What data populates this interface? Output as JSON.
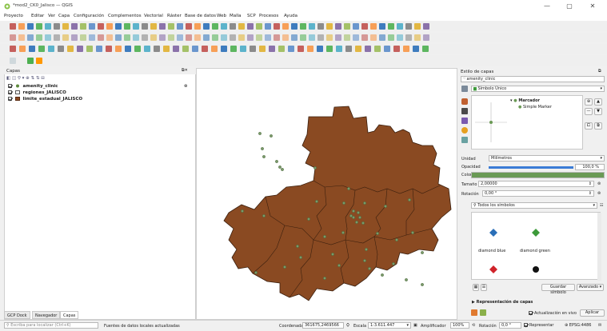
{
  "window": {
    "title": "*mod2_CK0_Jalisco — QGIS",
    "minimize": "—",
    "restore": "▢",
    "close": "✕"
  },
  "menu": [
    "Proyecto",
    "Editar",
    "Ver",
    "Capa",
    "Configuración",
    "Complementos",
    "Vectorial",
    "Ráster",
    "Base de datos",
    "Web",
    "Malla",
    "SCP",
    "Procesos",
    "Ayuda"
  ],
  "layers_panel": {
    "title": "Capas",
    "layers": [
      {
        "name": "amenity_clinic",
        "checked": true,
        "symbol": "point",
        "color": "#5d8a3c"
      },
      {
        "name": "regiones_JALISCO",
        "checked": true,
        "symbol": "empty",
        "color": "#ffffff"
      },
      {
        "name": "limite_estadual_JALISCO",
        "checked": true,
        "symbol": "fill",
        "color": "#8a4a22"
      }
    ],
    "tabs": [
      "GCP Dock",
      "Navegador",
      "Capas"
    ]
  },
  "style_panel": {
    "title": "Estilo de capas",
    "layer_select": "amenity_clinic",
    "renderer": "Símbolo Único",
    "tree_root": "Marcador",
    "tree_child": "Simple Marker",
    "unit_label": "Unidad",
    "unit_value": "Milímetros",
    "opacity_label": "Opacidad",
    "opacity_value": "100,0 %",
    "opacity_fraction": 1.0,
    "color_label": "Color",
    "color_value": "#6a9a55",
    "size_label": "Tamaño",
    "size_value": "2,00000",
    "rotation_label": "Rotación",
    "rotation_value": "0,00 °",
    "symbols_filter": "Todos los símbolos",
    "symbols": [
      {
        "name": "diamond blue",
        "color": "#2a6fb8",
        "shape": "diamond"
      },
      {
        "name": "diamond green",
        "color": "#3c9a3a",
        "shape": "diamond"
      },
      {
        "name": "",
        "color": "#d0232a",
        "shape": "diamond"
      },
      {
        "name": "",
        "color": "#111111",
        "shape": "circle"
      }
    ],
    "save_symbol": "Guardar símbolo",
    "advanced": "Avanzado ▾",
    "layer_render": "Representación de capas",
    "live_update": "Actualización en vivo",
    "apply": "Aplicar"
  },
  "status": {
    "search_placeholder": "Escriba para localizar (Ctrl+K)",
    "message": "Fuentes de datos locales actualizadas",
    "coord_label": "Coordenada",
    "coord_value": "361675,2469566",
    "scale_label": "Escala",
    "scale_value": "1:3.611.447",
    "magnifier_label": "Amplificador",
    "magnifier_value": "100%",
    "rotation_label": "Rotación",
    "rotation_value": "0,0 °",
    "render_label": "Representar",
    "crs": "EPSG:4486"
  },
  "map": {
    "fill_color": "#8a4a22",
    "point_color": "#7a9a6a"
  }
}
